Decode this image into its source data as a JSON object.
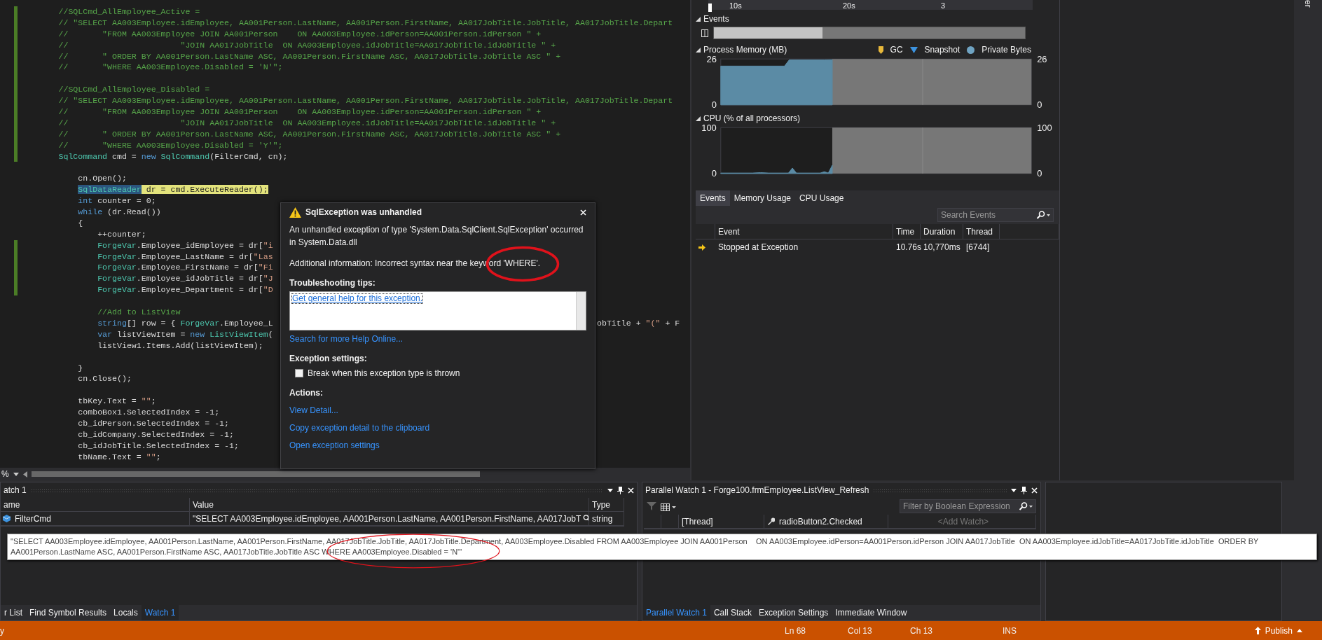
{
  "editor": {
    "lines": [
      {
        "changed": true,
        "segs": [
          {
            "text": "            //SQLCmd_AllEmployee_Active =",
            "kind": "comment"
          }
        ]
      },
      {
        "changed": true,
        "segs": [
          {
            "text": "            // \"SELECT AA003Employee.idEmployee, AA001Person.LastName, AA001Person.FirstName, AA017JobTitle.JobTitle, AA017JobTitle.Depart",
            "kind": "comment"
          }
        ]
      },
      {
        "changed": true,
        "segs": [
          {
            "text": "            //       \"FROM AA003Employee JOIN AA001Person    ON AA003Employee.idPerson=AA001Person.idPerson \" +",
            "kind": "comment"
          }
        ]
      },
      {
        "changed": true,
        "segs": [
          {
            "text": "            //                       \"JOIN AA017JobTitle  ON AA003Employee.idJobTitle=AA017JobTitle.idJobTitle \" +",
            "kind": "comment"
          }
        ]
      },
      {
        "changed": true,
        "segs": [
          {
            "text": "            //       \" ORDER BY AA001Person.LastName ASC, AA001Person.FirstName ASC, AA017JobTitle.JobTitle ASC \" +",
            "kind": "comment"
          }
        ]
      },
      {
        "changed": true,
        "segs": [
          {
            "text": "            //       \"WHERE AA003Employee.Disabled = 'N'\";",
            "kind": "comment"
          }
        ]
      },
      {
        "changed": true
      },
      {
        "changed": true,
        "segs": [
          {
            "text": "            //SQLCmd_AllEmployee_Disabled =",
            "kind": "comment"
          }
        ]
      },
      {
        "changed": true,
        "segs": [
          {
            "text": "            // \"SELECT AA003Employee.idEmployee, AA001Person.LastName, AA001Person.FirstName, AA017JobTitle.JobTitle, AA017JobTitle.Depart",
            "kind": "comment"
          }
        ]
      },
      {
        "changed": true,
        "segs": [
          {
            "text": "            //       \"FROM AA003Employee JOIN AA001Person    ON AA003Employee.idPerson=AA001Person.idPerson \" +",
            "kind": "comment"
          }
        ]
      },
      {
        "changed": true,
        "segs": [
          {
            "text": "            //                       \"JOIN AA017JobTitle  ON AA003Employee.idJobTitle=AA017JobTitle.idJobTitle \" +",
            "kind": "comment"
          }
        ]
      },
      {
        "changed": true,
        "segs": [
          {
            "text": "            //       \" ORDER BY AA001Person.LastName ASC, AA001Person.FirstName ASC, AA017JobTitle.JobTitle ASC \" +",
            "kind": "comment"
          }
        ]
      },
      {
        "changed": true,
        "segs": [
          {
            "text": "            //       \"WHERE AA003Employee.Disabled = 'Y'\";",
            "kind": "comment"
          }
        ]
      },
      {
        "changed": true,
        "segs": [
          {
            "text": "            SqlCommand",
            "kind": "type"
          },
          {
            "text": " cmd = ",
            "kind": "plain"
          },
          {
            "text": "new",
            "kind": "keyword"
          },
          {
            "text": " SqlCommand",
            "kind": "type"
          },
          {
            "text": "(FilterCmd, cn);",
            "kind": "plain"
          }
        ]
      },
      {
        "changed": false
      },
      {
        "changed": false,
        "segs": [
          {
            "text": "                cn.Open();",
            "kind": "plain"
          }
        ]
      },
      {
        "changed": false,
        "segs": [
          {
            "text": "                SqlDataReader",
            "kind": "selection"
          },
          {
            "text": " dr = cmd.ExecuteReader();",
            "kind": "current"
          }
        ]
      },
      {
        "changed": false,
        "segs": [
          {
            "text": "                int",
            "kind": "keyword"
          },
          {
            "text": " counter = 0;",
            "kind": "plain"
          }
        ]
      },
      {
        "changed": false,
        "segs": [
          {
            "text": "                while",
            "kind": "keyword"
          },
          {
            "text": " (dr.Read())",
            "kind": "plain"
          }
        ]
      },
      {
        "changed": false,
        "segs": [
          {
            "text": "                {",
            "kind": "plain"
          }
        ]
      },
      {
        "changed": false,
        "segs": [
          {
            "text": "                    ++counter;",
            "kind": "plain"
          }
        ]
      },
      {
        "changed": true,
        "segs": [
          {
            "text": "                    ForgeVar",
            "kind": "type"
          },
          {
            "text": ".Employee_idEmployee = dr[",
            "kind": "plain"
          },
          {
            "text": "\"i",
            "kind": "string"
          }
        ]
      },
      {
        "changed": true,
        "segs": [
          {
            "text": "                    ForgeVar",
            "kind": "type"
          },
          {
            "text": ".Employee_LastName = dr[",
            "kind": "plain"
          },
          {
            "text": "\"Las",
            "kind": "string"
          }
        ]
      },
      {
        "changed": true,
        "segs": [
          {
            "text": "                    ForgeVar",
            "kind": "type"
          },
          {
            "text": ".Employee_FirstName = dr[",
            "kind": "plain"
          },
          {
            "text": "\"Fi",
            "kind": "string"
          }
        ]
      },
      {
        "changed": true,
        "segs": [
          {
            "text": "                    ForgeVar",
            "kind": "type"
          },
          {
            "text": ".Employee_idJobTitle = dr[",
            "kind": "plain"
          },
          {
            "text": "\"J",
            "kind": "string"
          }
        ]
      },
      {
        "changed": true,
        "segs": [
          {
            "text": "                    ForgeVar",
            "kind": "type"
          },
          {
            "text": ".Employee_Department = dr[",
            "kind": "plain"
          },
          {
            "text": "\"D",
            "kind": "string"
          }
        ]
      },
      {
        "changed": false
      },
      {
        "changed": false,
        "segs": [
          {
            "text": "                    //Add to ListView",
            "kind": "comment"
          }
        ]
      },
      {
        "changed": false,
        "segs": [
          {
            "text": "                    string",
            "kind": "keyword"
          },
          {
            "text": "[] row = { ",
            "kind": "plain"
          },
          {
            "text": "ForgeVar",
            "kind": "type"
          },
          {
            "text": ".Employee_L",
            "kind": "plain"
          }
        ],
        "tail": [
          {
            "text": "obTitle + ",
            "kind": "plain"
          },
          {
            "text": "\"(\"",
            "kind": "string"
          },
          {
            "text": " + F",
            "kind": "plain"
          }
        ]
      },
      {
        "changed": false,
        "segs": [
          {
            "text": "                    var",
            "kind": "keyword"
          },
          {
            "text": " listViewItem = ",
            "kind": "plain"
          },
          {
            "text": "new",
            "kind": "keyword"
          },
          {
            "text": " ListViewItem",
            "kind": "type"
          },
          {
            "text": "(",
            "kind": "plain"
          }
        ]
      },
      {
        "changed": false,
        "segs": [
          {
            "text": "                    listView1.Items.Add(listViewItem);",
            "kind": "plain"
          }
        ]
      },
      {
        "changed": false
      },
      {
        "changed": false,
        "segs": [
          {
            "text": "                }",
            "kind": "plain"
          }
        ]
      },
      {
        "changed": false,
        "segs": [
          {
            "text": "                cn.Close();",
            "kind": "plain"
          }
        ]
      },
      {
        "changed": false
      },
      {
        "changed": false,
        "segs": [
          {
            "text": "                tbKey.Text = ",
            "kind": "plain"
          },
          {
            "text": "\"\"",
            "kind": "string"
          },
          {
            "text": ";",
            "kind": "plain"
          }
        ]
      },
      {
        "changed": false,
        "segs": [
          {
            "text": "                comboBox1.SelectedIndex = -1;",
            "kind": "plain"
          }
        ]
      },
      {
        "changed": false,
        "segs": [
          {
            "text": "                cb_idPerson.SelectedIndex = -1;",
            "kind": "plain"
          }
        ]
      },
      {
        "changed": false,
        "segs": [
          {
            "text": "                cb_idCompany.SelectedIndex = -1;",
            "kind": "plain"
          }
        ]
      },
      {
        "changed": false,
        "segs": [
          {
            "text": "                cb_idJobTitle.SelectedIndex = -1;",
            "kind": "plain"
          }
        ]
      },
      {
        "changed": false,
        "segs": [
          {
            "text": "                tbName.Text = ",
            "kind": "plain"
          },
          {
            "text": "\"\"",
            "kind": "string"
          },
          {
            "text": ";",
            "kind": "plain"
          }
        ]
      }
    ],
    "zoom": "%"
  },
  "exception_popup": {
    "title": "SqlException was unhandled",
    "message": "An unhandled exception of type 'System.Data.SqlClient.SqlException' occurred in System.Data.dll",
    "additional_info": "Additional information: Incorrect syntax near the keyword 'WHERE'.",
    "tips_heading": "Troubleshooting tips:",
    "tips_link": "Get general help for this exception.",
    "help_link": "Search for more Help Online...",
    "settings_heading": "Exception settings:",
    "checkbox": {
      "label": "Break when this exception type is thrown",
      "checked": false
    },
    "actions_heading": "Actions:",
    "actions": [
      "View Detail...",
      "Copy exception detail to the clipboard",
      "Open exception settings"
    ]
  },
  "diagnostics": {
    "ruler": [
      "10s",
      "20s",
      "3"
    ],
    "events": {
      "title": "Events",
      "level": 0.35
    },
    "memory": {
      "title": "Process Memory (MB)",
      "legend": [
        {
          "label": "GC",
          "color": "#e8b83a",
          "kind": "pin"
        },
        {
          "label": "Snapshot",
          "color": "#3c93e0",
          "kind": "triangle"
        },
        {
          "label": "Private Bytes",
          "color": "#6fa3c2",
          "kind": "dot"
        }
      ],
      "left_axis": [
        "26",
        "0"
      ],
      "right_axis": [
        "26",
        "0"
      ]
    },
    "cpu": {
      "title": "CPU (% of all processors)",
      "left_axis": [
        "100",
        "0"
      ],
      "right_axis": [
        "100",
        "0"
      ]
    },
    "tabs": [
      {
        "label": "Events",
        "selected": true
      },
      {
        "label": "Memory Usage",
        "selected": false
      },
      {
        "label": "CPU Usage",
        "selected": false
      }
    ],
    "search": {
      "placeholder": "Search Events"
    },
    "table": {
      "columns": [
        "Event",
        "Time",
        "Duration",
        "Thread"
      ],
      "rows": [
        {
          "event": "Stopped at Exception",
          "time": "10.76s",
          "duration": "10,770ms",
          "thread": "[6744]"
        }
      ]
    }
  },
  "watch": {
    "title": "atch 1",
    "columns": [
      "ame",
      "Value",
      "Type"
    ],
    "rows": [
      {
        "name": "FilterCmd",
        "value": "\"SELECT AA003Employee.idEmployee, AA001Person.LastName, AA001Person.FirstName, AA017JobT",
        "type": "string"
      }
    ],
    "tooltip": [
      "\"SELECT AA003Employee.idEmployee, AA001Person.LastName, AA001Person.FirstName, AA017JobTitle.JobTitle, AA017JobTitle.Department, AA003Employee.Disabled FROM AA003Employee JOIN AA001Person    ON AA003Employee.idPerson=AA001Person.idPerson JOIN AA017JobTitle  ON AA003Employee.idJobTitle=AA017JobTitle.idJobTitle  ORDER BY",
      "AA001Person.LastName ASC, AA001Person.FirstName ASC, AA017JobTitle.JobTitle ASC WHERE AA003Employee.Disabled = 'N'\""
    ],
    "tabs": [
      {
        "label": "r List",
        "selected": false
      },
      {
        "label": "Find Symbol Results",
        "selected": false
      },
      {
        "label": "Locals",
        "selected": false
      },
      {
        "label": "Watch 1",
        "selected": true
      }
    ]
  },
  "parallel_watch": {
    "title": "Parallel Watch 1 - Forge100.frmEmployee.ListView_Refresh",
    "filter": {
      "placeholder": "Filter by Boolean Expression"
    },
    "columns": [
      "[Thread]",
      "radioButton2.Checked",
      "<Add Watch>"
    ],
    "tabs": [
      {
        "label": "Parallel Watch 1",
        "selected": true
      },
      {
        "label": "Call Stack",
        "selected": false
      },
      {
        "label": "Exception Settings",
        "selected": false
      },
      {
        "label": "Immediate Window",
        "selected": false
      }
    ]
  },
  "status_bar": {
    "message": "y",
    "line": "Ln 68",
    "column": "Col 13",
    "char": "Ch 13",
    "mode": "INS",
    "publish": "Publish"
  },
  "side_strip": {
    "label": "er"
  }
}
